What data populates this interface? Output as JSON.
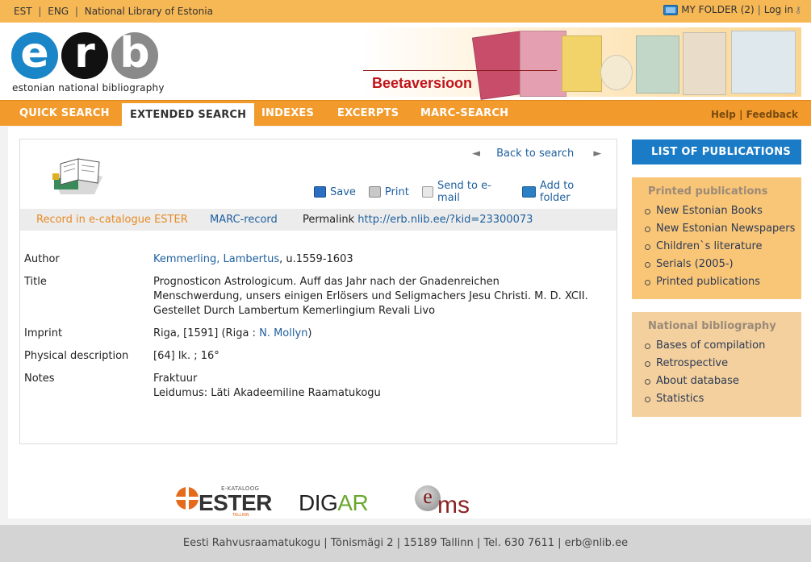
{
  "topbar": {
    "lang_est": "EST",
    "lang_eng": "ENG",
    "library": "National Library of Estonia",
    "my_folder": "MY FOLDER (2)",
    "login": "Log in"
  },
  "header": {
    "logo_letters": [
      "e",
      "r",
      "b"
    ],
    "logo_tagline": "estonian national bibliography",
    "beta": "Beetaversioon"
  },
  "nav": {
    "tabs": [
      "QUICK SEARCH",
      "EXTENDED SEARCH",
      "INDEXES",
      "EXCERPTS",
      "MARC-SEARCH"
    ],
    "active_tab": "EXTENDED SEARCH",
    "help": "Help",
    "feedback": "Feedback"
  },
  "record": {
    "back_to_search": "Back to search",
    "prev_arrow": "◄",
    "next_arrow": "►",
    "actions": {
      "save": "Save",
      "print": "Print",
      "send_email": "Send to e-mail",
      "add_folder": "Add to folder"
    },
    "links": {
      "ester": "Record in e-catalogue ESTER",
      "marc": "MARC-record",
      "permalink_label": "Permalink",
      "permalink_url": "http://erb.nlib.ee/?kid=23300073"
    },
    "fields": {
      "author_label": "Author",
      "author_link": "Kemmerling, Lambertus",
      "author_rest": ", u.1559-1603",
      "title_label": "Title",
      "title_value": "Prognosticon Astrologicum. Auff das Jahr nach der Gnadenreichen Menschwerdung, unsers einigen Erlösers und Seligmachers Jesu Christi. M. D. XCII. Gestellet Durch Lambertum Kemerlingium Revali Livo",
      "imprint_label": "Imprint",
      "imprint_pre": "Riga, [1591] (Riga : ",
      "imprint_link": "N. Mollyn",
      "imprint_post": ")",
      "physical_label": "Physical description",
      "physical_value": "[64] lk. ; 16°",
      "notes_label": "Notes",
      "notes_line1": "Fraktuur",
      "notes_line2": "Leidumus: Läti Akadeemiline Raamatukogu"
    }
  },
  "sidebar": {
    "list_button": "LIST OF PUBLICATIONS",
    "printed": {
      "heading": "Printed publications",
      "items": [
        "New Estonian Books",
        "New Estonian Newspapers",
        "Children`s literature",
        "Serials (2005-)",
        "Printed publications"
      ]
    },
    "national": {
      "heading": "National bibliography",
      "items": [
        "Bases of compilation",
        "Retrospective",
        "About database",
        "Statistics"
      ]
    }
  },
  "partners": {
    "ester_small": "E-KATALOOG",
    "ester_big": "ESTER",
    "ester_sub": "TALLINN",
    "digar_d": "DIG",
    "digar_a": "AR",
    "ems_e": "e",
    "ems_rest": "ms"
  },
  "footer": {
    "text": "Eesti Rahvusraamatukogu | Tõnismägi 2 | 15189 Tallinn | Tel. 630 7611 | erb@nlib.ee"
  },
  "colors": {
    "orange_bar": "#f29b2c",
    "top_bar": "#f6b755",
    "link_blue": "#1e5f9e",
    "accent_blue": "#1a7bc7"
  }
}
